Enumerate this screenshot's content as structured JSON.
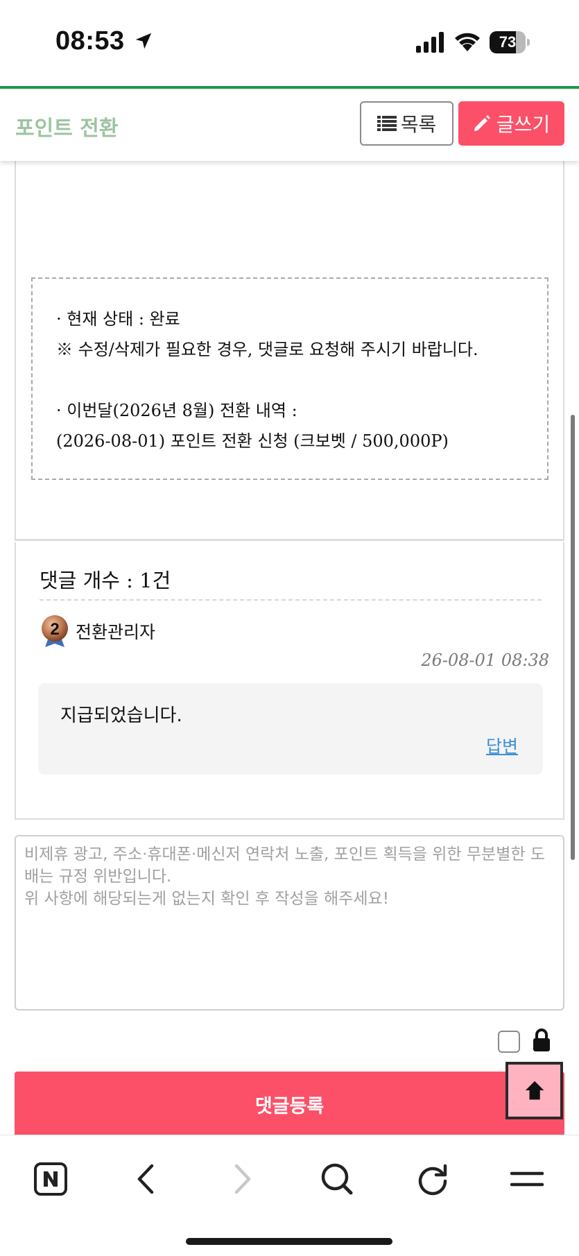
{
  "status_bar": {
    "time": "08:53",
    "battery": "73",
    "battery_level": 0.73
  },
  "header": {
    "title": "포인트 전환",
    "list_label": "목록",
    "write_label": "글쓰기",
    "accent_color": "#fb5068",
    "title_color": "#9cc4a0"
  },
  "article": {
    "status_line": "·  현재 상태 : 완료",
    "notice": "※ 수정/삭제가 필요한 경우, 댓글로 요청해 주시기 바랍니다.",
    "history_title": "·  이번달(2026년 8월) 전환 내역 :",
    "history_entry": "(2026-08-01) 포인트 전환 신청 (크보벳 / 500,000P)"
  },
  "comments": {
    "count_label": "댓글 개수 : 1건",
    "items": [
      {
        "author": "전환관리자",
        "level": "2",
        "date": "26-08-01 08:38",
        "text": "지급되었습니다.",
        "reply_label": "답변"
      }
    ]
  },
  "comment_form": {
    "placeholder": "비제휴 광고, 주소·휴대폰·메신저 연락처 노출, 포인트 획득을 위한 무분별한 도배는 규정 위반입니다.\n위 사항에 해당되는게 없는지 확인 후 작성을 해주세요!",
    "value": "",
    "submit_label": "댓글등록",
    "secret_checked": false
  },
  "icons": {
    "list": "list-icon",
    "write": "pencil-icon",
    "lock": "lock-icon",
    "scroll_top": "arrow-up-icon",
    "browser_home": "naver-n-icon",
    "back": "chevron-left-icon",
    "forward": "chevron-right-icon",
    "search": "search-icon",
    "reload": "reload-icon",
    "menu": "menu-icon"
  }
}
